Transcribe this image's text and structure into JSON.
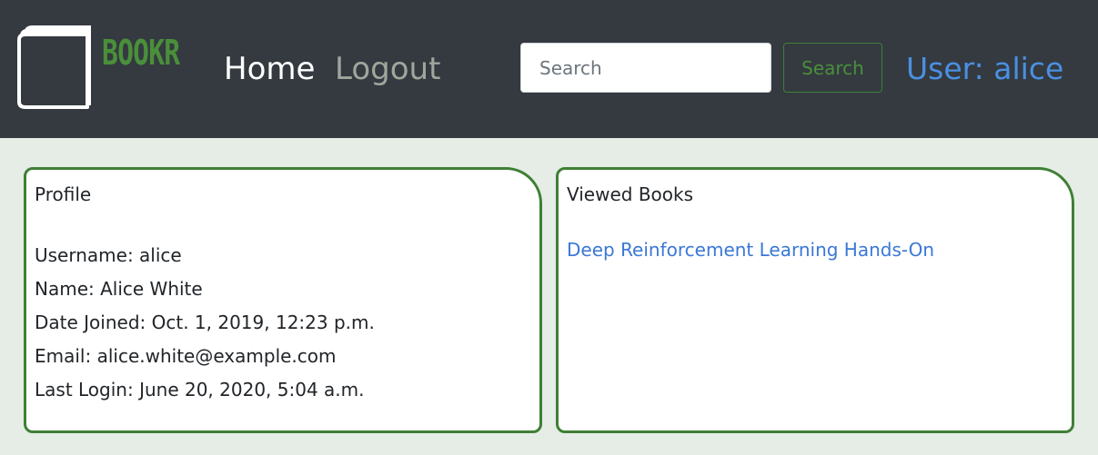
{
  "colors": {
    "navbar_bg": "#343a40",
    "page_bg": "#e5ede6",
    "brand_green": "#4a8f3a",
    "link_blue": "#4a90e2",
    "card_border": "#3f7f35"
  },
  "navbar": {
    "logo_icon": "book-icon",
    "brand": "BOOKR",
    "links": [
      {
        "label": "Home"
      },
      {
        "label": "Logout"
      }
    ],
    "search": {
      "placeholder": "Search",
      "value": "",
      "button_label": "Search"
    },
    "user_label": "User: alice"
  },
  "profile_card": {
    "title": "Profile",
    "lines": [
      "Username: alice",
      "Name: Alice White",
      "Date Joined: Oct. 1, 2019, 12:23 p.m.",
      "Email: alice.white@example.com",
      "Last Login: June 20, 2020, 5:04 a.m."
    ]
  },
  "viewed_card": {
    "title": "Viewed Books",
    "books": [
      {
        "title": "Deep Reinforcement Learning Hands-On"
      }
    ]
  }
}
